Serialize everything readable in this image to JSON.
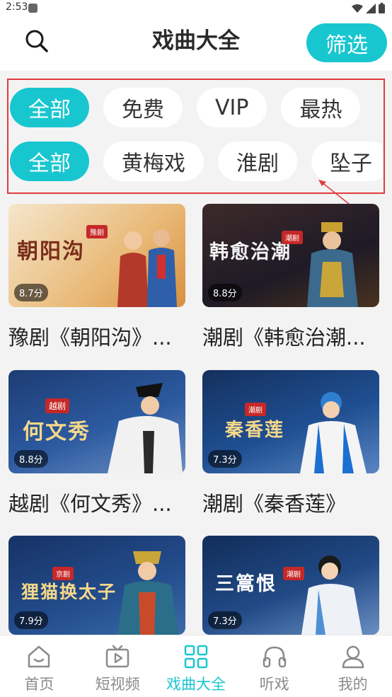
{
  "status_bar": {
    "time": "2:53"
  },
  "header": {
    "title": "戏曲大全",
    "filter_label": "筛选"
  },
  "filters": {
    "row1": [
      "全部",
      "免费",
      "VIP",
      "最热"
    ],
    "row2": [
      "全部",
      "黄梅戏",
      "淮剧",
      "坠子"
    ]
  },
  "cards": [
    {
      "thumb_title": "朝阳沟",
      "tag": "豫剧",
      "score": "8.7分",
      "title": "豫剧《朝阳沟》..."
    },
    {
      "thumb_title": "韩愈治潮",
      "tag": "潮剧",
      "score": "8.8分",
      "title": "潮剧《韩愈治潮..."
    },
    {
      "thumb_title": "何文秀",
      "tag": "越剧",
      "score": "8.8分",
      "title": "越剧《何文秀》..."
    },
    {
      "thumb_title": "秦香莲",
      "tag": "潮剧",
      "score": "7.3分",
      "title": "潮剧《秦香莲》"
    },
    {
      "thumb_title": "狸猫换太子",
      "tag": "京剧",
      "score": "7.9分",
      "title": ""
    },
    {
      "thumb_title": "三篙恨",
      "tag": "潮剧",
      "score": "7.3分",
      "title": ""
    }
  ],
  "tabs": [
    {
      "label": "首页",
      "icon": "home-icon"
    },
    {
      "label": "短视频",
      "icon": "tv-icon"
    },
    {
      "label": "戏曲大全",
      "icon": "grid-icon"
    },
    {
      "label": "听戏",
      "icon": "headphones-icon"
    },
    {
      "label": "我的",
      "icon": "user-icon"
    }
  ],
  "colors": {
    "accent": "#18c6cf",
    "highlight": "#e23b3b"
  }
}
